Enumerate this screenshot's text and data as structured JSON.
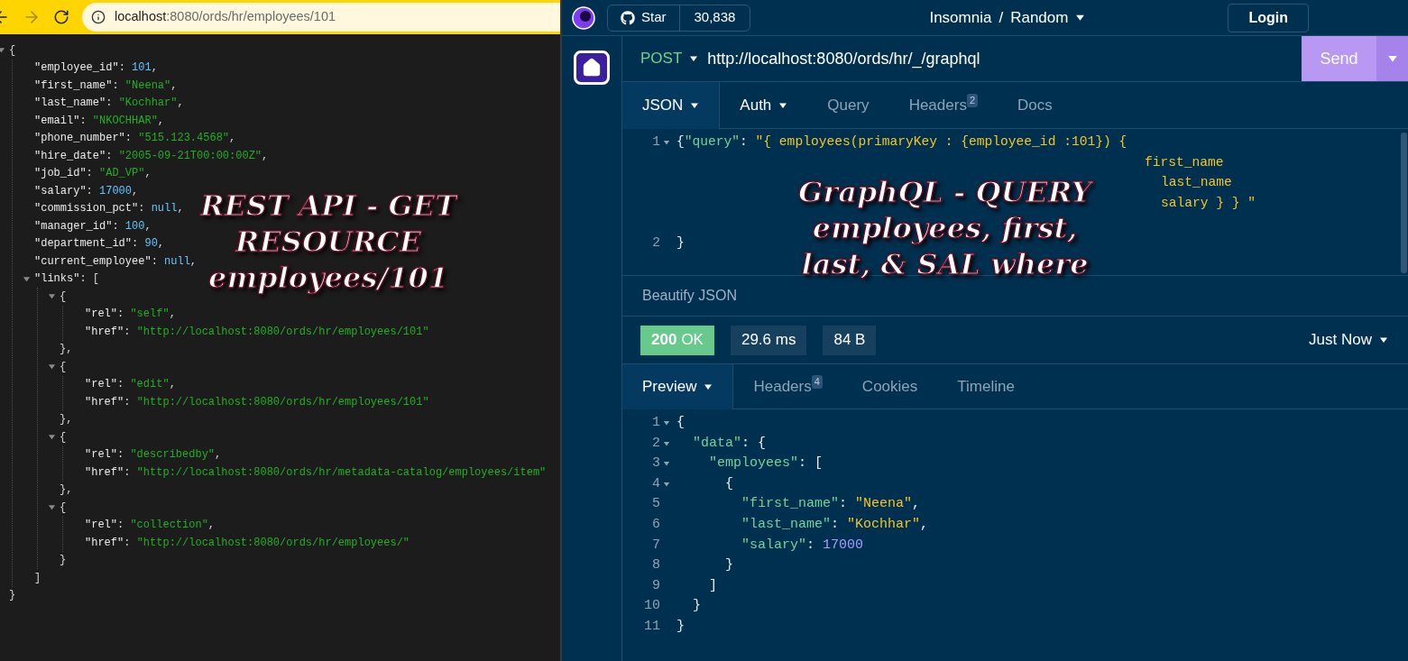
{
  "browser": {
    "address": {
      "host": "localhost",
      "path": ":8080/ords/hr/employees/101"
    },
    "json_viewer": {
      "tokens": [
        {
          "kind": "punct",
          "text": "{"
        }
      ],
      "expanded": true,
      "children": [
        {
          "tokens": [
            {
              "kind": "key",
              "text": "\"employee_id\""
            },
            {
              "kind": "punct",
              "text": ": "
            },
            {
              "kind": "number",
              "text": "101"
            },
            {
              "kind": "punct",
              "text": ","
            }
          ]
        },
        {
          "tokens": [
            {
              "kind": "key",
              "text": "\"first_name\""
            },
            {
              "kind": "punct",
              "text": ": "
            },
            {
              "kind": "string",
              "text": "\"Neena\""
            },
            {
              "kind": "punct",
              "text": ","
            }
          ]
        },
        {
          "tokens": [
            {
              "kind": "key",
              "text": "\"last_name\""
            },
            {
              "kind": "punct",
              "text": ": "
            },
            {
              "kind": "string",
              "text": "\"Kochhar\""
            },
            {
              "kind": "punct",
              "text": ","
            }
          ]
        },
        {
          "tokens": [
            {
              "kind": "key",
              "text": "\"email\""
            },
            {
              "kind": "punct",
              "text": ": "
            },
            {
              "kind": "string",
              "text": "\"NKOCHHAR\""
            },
            {
              "kind": "punct",
              "text": ","
            }
          ]
        },
        {
          "tokens": [
            {
              "kind": "key",
              "text": "\"phone_number\""
            },
            {
              "kind": "punct",
              "text": ": "
            },
            {
              "kind": "string",
              "text": "\"515.123.4568\""
            },
            {
              "kind": "punct",
              "text": ","
            }
          ]
        },
        {
          "tokens": [
            {
              "kind": "key",
              "text": "\"hire_date\""
            },
            {
              "kind": "punct",
              "text": ": "
            },
            {
              "kind": "string",
              "text": "\"2005-09-21T00:00:00Z\""
            },
            {
              "kind": "punct",
              "text": ","
            }
          ]
        },
        {
          "tokens": [
            {
              "kind": "key",
              "text": "\"job_id\""
            },
            {
              "kind": "punct",
              "text": ": "
            },
            {
              "kind": "string",
              "text": "\"AD_VP\""
            },
            {
              "kind": "punct",
              "text": ","
            }
          ]
        },
        {
          "tokens": [
            {
              "kind": "key",
              "text": "\"salary\""
            },
            {
              "kind": "punct",
              "text": ": "
            },
            {
              "kind": "number",
              "text": "17000"
            },
            {
              "kind": "punct",
              "text": ","
            }
          ]
        },
        {
          "tokens": [
            {
              "kind": "key",
              "text": "\"commission_pct\""
            },
            {
              "kind": "punct",
              "text": ": "
            },
            {
              "kind": "null",
              "text": "null"
            },
            {
              "kind": "punct",
              "text": ","
            }
          ]
        },
        {
          "tokens": [
            {
              "kind": "key",
              "text": "\"manager_id\""
            },
            {
              "kind": "punct",
              "text": ": "
            },
            {
              "kind": "number",
              "text": "100"
            },
            {
              "kind": "punct",
              "text": ","
            }
          ]
        },
        {
          "tokens": [
            {
              "kind": "key",
              "text": "\"department_id\""
            },
            {
              "kind": "punct",
              "text": ": "
            },
            {
              "kind": "number",
              "text": "90"
            },
            {
              "kind": "punct",
              "text": ","
            }
          ]
        },
        {
          "tokens": [
            {
              "kind": "key",
              "text": "\"current_employee\""
            },
            {
              "kind": "punct",
              "text": ": "
            },
            {
              "kind": "null",
              "text": "null"
            },
            {
              "kind": "punct",
              "text": ","
            }
          ]
        },
        {
          "tokens": [
            {
              "kind": "key",
              "text": "\"links\""
            },
            {
              "kind": "punct",
              "text": ": "
            },
            {
              "kind": "punct",
              "text": "["
            }
          ],
          "expanded": true,
          "children": [
            {
              "tokens": [
                {
                  "kind": "punct",
                  "text": "{"
                }
              ],
              "expanded": true,
              "children": [
                {
                  "tokens": [
                    {
                      "kind": "key",
                      "text": "\"rel\""
                    },
                    {
                      "kind": "punct",
                      "text": ": "
                    },
                    {
                      "kind": "string",
                      "text": "\"self\""
                    },
                    {
                      "kind": "punct",
                      "text": ","
                    }
                  ]
                },
                {
                  "tokens": [
                    {
                      "kind": "key",
                      "text": "\"href\""
                    },
                    {
                      "kind": "punct",
                      "text": ": "
                    },
                    {
                      "kind": "string",
                      "text": "\"http://localhost:8080/ords/hr/employees/101\""
                    }
                  ]
                }
              ],
              "close": [
                {
                  "kind": "punct",
                  "text": "},"
                }
              ]
            },
            {
              "tokens": [
                {
                  "kind": "punct",
                  "text": "{"
                }
              ],
              "expanded": true,
              "children": [
                {
                  "tokens": [
                    {
                      "kind": "key",
                      "text": "\"rel\""
                    },
                    {
                      "kind": "punct",
                      "text": ": "
                    },
                    {
                      "kind": "string",
                      "text": "\"edit\""
                    },
                    {
                      "kind": "punct",
                      "text": ","
                    }
                  ]
                },
                {
                  "tokens": [
                    {
                      "kind": "key",
                      "text": "\"href\""
                    },
                    {
                      "kind": "punct",
                      "text": ": "
                    },
                    {
                      "kind": "string",
                      "text": "\"http://localhost:8080/ords/hr/employees/101\""
                    }
                  ]
                }
              ],
              "close": [
                {
                  "kind": "punct",
                  "text": "},"
                }
              ]
            },
            {
              "tokens": [
                {
                  "kind": "punct",
                  "text": "{"
                }
              ],
              "expanded": true,
              "children": [
                {
                  "tokens": [
                    {
                      "kind": "key",
                      "text": "\"rel\""
                    },
                    {
                      "kind": "punct",
                      "text": ": "
                    },
                    {
                      "kind": "string",
                      "text": "\"describedby\""
                    },
                    {
                      "kind": "punct",
                      "text": ","
                    }
                  ]
                },
                {
                  "tokens": [
                    {
                      "kind": "key",
                      "text": "\"href\""
                    },
                    {
                      "kind": "punct",
                      "text": ": "
                    },
                    {
                      "kind": "string",
                      "text": "\"http://localhost:8080/ords/hr/metadata-catalog/employees/item\""
                    }
                  ]
                }
              ],
              "close": [
                {
                  "kind": "punct",
                  "text": "},"
                }
              ]
            },
            {
              "tokens": [
                {
                  "kind": "punct",
                  "text": "{"
                }
              ],
              "expanded": true,
              "children": [
                {
                  "tokens": [
                    {
                      "kind": "key",
                      "text": "\"rel\""
                    },
                    {
                      "kind": "punct",
                      "text": ": "
                    },
                    {
                      "kind": "string",
                      "text": "\"collection\""
                    },
                    {
                      "kind": "punct",
                      "text": ","
                    }
                  ]
                },
                {
                  "tokens": [
                    {
                      "kind": "key",
                      "text": "\"href\""
                    },
                    {
                      "kind": "punct",
                      "text": ": "
                    },
                    {
                      "kind": "string",
                      "text": "\"http://localhost:8080/ords/hr/employees/\""
                    }
                  ]
                }
              ],
              "close": [
                {
                  "kind": "punct",
                  "text": "}"
                }
              ]
            }
          ],
          "close": [
            {
              "kind": "punct",
              "text": "]"
            }
          ]
        }
      ],
      "close": [
        {
          "kind": "punct",
          "text": "}"
        }
      ]
    },
    "annotation": [
      "REST API - GET",
      "RESOURCE",
      "employees/101"
    ]
  },
  "insomnia": {
    "github": {
      "label": "Star",
      "count": "30,838"
    },
    "title": {
      "org": "Insomnia",
      "separator": "/",
      "project": "Random"
    },
    "login": "Login",
    "request": {
      "method": "POST",
      "url": "http://localhost:8080/ords/hr/_/graphql",
      "send": "Send"
    },
    "request_tabs": [
      {
        "label": "JSON",
        "selected": true,
        "dropdown": true
      },
      {
        "label": "Auth",
        "selected": false,
        "dropdown": true
      },
      {
        "label": "Query",
        "selected": false,
        "dropdown": false
      },
      {
        "label": "Headers",
        "badge": "2",
        "selected": false,
        "dropdown": false
      },
      {
        "label": "Docs",
        "selected": false,
        "dropdown": false
      }
    ],
    "body_lines": [
      {
        "n": "1",
        "fold": true,
        "tokens": [
          {
            "kind": "punct",
            "text": "{"
          },
          {
            "kind": "key",
            "text": "\"query\""
          },
          {
            "kind": "punct",
            "text": ": "
          },
          {
            "kind": "string",
            "text": "\"{ employees(primaryKey : {employee_id :101}) {"
          }
        ],
        "wrap": [
          "first_name",
          "last_name",
          "salary } } \""
        ]
      },
      {
        "n": "2",
        "fold": false,
        "tokens": [
          {
            "kind": "punct",
            "text": "}"
          }
        ]
      }
    ],
    "beautify": "Beautify JSON",
    "status": {
      "code": "200",
      "text": "OK",
      "time": "29.6 ms",
      "size": "84 B",
      "when": "Just Now"
    },
    "response_tabs": [
      {
        "label": "Preview",
        "selected": true,
        "dropdown": true
      },
      {
        "label": "Headers",
        "badge": "4",
        "selected": false,
        "dropdown": false
      },
      {
        "label": "Cookies",
        "selected": false,
        "dropdown": false
      },
      {
        "label": "Timeline",
        "selected": false,
        "dropdown": false
      }
    ],
    "response": {
      "n": "1",
      "fold": true,
      "tokens": [
        {
          "kind": "punct",
          "text": "{"
        }
      ],
      "children": [
        {
          "n": "2",
          "fold": true,
          "tokens": [
            {
              "kind": "key",
              "text": "\"data\""
            },
            {
              "kind": "punct",
              "text": ": "
            },
            {
              "kind": "punct",
              "text": "{"
            }
          ],
          "children": [
            {
              "n": "3",
              "fold": true,
              "tokens": [
                {
                  "kind": "key",
                  "text": "\"employees\""
                },
                {
                  "kind": "punct",
                  "text": ": "
                },
                {
                  "kind": "punct",
                  "text": "["
                }
              ],
              "children": [
                {
                  "n": "4",
                  "fold": true,
                  "tokens": [
                    {
                      "kind": "punct",
                      "text": "{"
                    }
                  ],
                  "children": [
                    {
                      "n": "5",
                      "fold": false,
                      "tokens": [
                        {
                          "kind": "key",
                          "text": "\"first_name\""
                        },
                        {
                          "kind": "punct",
                          "text": ": "
                        },
                        {
                          "kind": "string",
                          "text": "\"Neena\""
                        },
                        {
                          "kind": "punct",
                          "text": ","
                        }
                      ]
                    },
                    {
                      "n": "6",
                      "fold": false,
                      "tokens": [
                        {
                          "kind": "key",
                          "text": "\"last_name\""
                        },
                        {
                          "kind": "punct",
                          "text": ": "
                        },
                        {
                          "kind": "string",
                          "text": "\"Kochhar\""
                        },
                        {
                          "kind": "punct",
                          "text": ","
                        }
                      ]
                    },
                    {
                      "n": "7",
                      "fold": false,
                      "tokens": [
                        {
                          "kind": "key",
                          "text": "\"salary\""
                        },
                        {
                          "kind": "punct",
                          "text": ": "
                        },
                        {
                          "kind": "number",
                          "text": "17000"
                        }
                      ]
                    }
                  ],
                  "close": {
                    "n": "8",
                    "tokens": [
                      {
                        "kind": "punct",
                        "text": "}"
                      }
                    ]
                  }
                }
              ],
              "close": {
                "n": "9",
                "tokens": [
                  {
                    "kind": "punct",
                    "text": "]"
                  }
                ]
              }
            }
          ],
          "close": {
            "n": "10",
            "tokens": [
              {
                "kind": "punct",
                "text": "}"
              }
            ]
          }
        }
      ],
      "close": {
        "n": "11",
        "tokens": [
          {
            "kind": "punct",
            "text": "}"
          }
        ]
      }
    },
    "annotation": [
      "GraphQL - QUERY",
      "employees, first,",
      "last, & SAL where"
    ]
  }
}
